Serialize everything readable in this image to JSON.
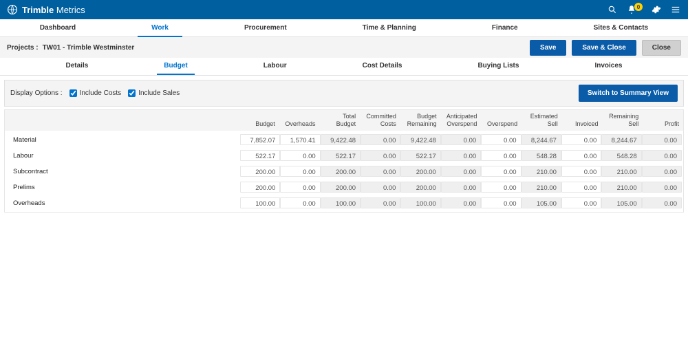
{
  "brand": {
    "logo_name": "trimble-logo",
    "name_bold": "Trimble",
    "name_light": "Metrics"
  },
  "topbar": {
    "notification_count": "0"
  },
  "main_tabs": {
    "items": [
      "Dashboard",
      "Work",
      "Procurement",
      "Time & Planning",
      "Finance",
      "Sites & Contacts"
    ],
    "active_index": 1
  },
  "project_bar": {
    "label": "Projects :",
    "value": "TW01 - Trimble Westminster",
    "save": "Save",
    "save_close": "Save & Close",
    "close": "Close"
  },
  "sub_tabs": {
    "items": [
      "Details",
      "Budget",
      "Labour",
      "Cost Details",
      "Buying Lists",
      "Invoices"
    ],
    "active_index": 1
  },
  "options": {
    "label": "Display Options :",
    "include_costs": "Include Costs",
    "include_sales": "Include Sales",
    "switch_button": "Switch to Summary View",
    "include_costs_checked": true,
    "include_sales_checked": true
  },
  "grid": {
    "headers": [
      "",
      "Budget",
      "Overheads",
      "Total Budget",
      "Committed Costs",
      "Budget Remaining",
      "Anticipated Overspend",
      "Overspend",
      "Estimated Sell",
      "Invoiced",
      "Remaining Sell",
      "Profit"
    ],
    "editable_cols": [
      1,
      2,
      7,
      9
    ],
    "rows": [
      {
        "label": "Material",
        "cells": [
          "7,852.07",
          "1,570.41",
          "9,422.48",
          "0.00",
          "9,422.48",
          "0.00",
          "0.00",
          "8,244.67",
          "0.00",
          "8,244.67",
          "0.00"
        ]
      },
      {
        "label": "Labour",
        "cells": [
          "522.17",
          "0.00",
          "522.17",
          "0.00",
          "522.17",
          "0.00",
          "0.00",
          "548.28",
          "0.00",
          "548.28",
          "0.00"
        ]
      },
      {
        "label": "Subcontract",
        "cells": [
          "200.00",
          "0.00",
          "200.00",
          "0.00",
          "200.00",
          "0.00",
          "0.00",
          "210.00",
          "0.00",
          "210.00",
          "0.00"
        ]
      },
      {
        "label": "Prelims",
        "cells": [
          "200.00",
          "0.00",
          "200.00",
          "0.00",
          "200.00",
          "0.00",
          "0.00",
          "210.00",
          "0.00",
          "210.00",
          "0.00"
        ]
      },
      {
        "label": "Overheads",
        "cells": [
          "100.00",
          "0.00",
          "100.00",
          "0.00",
          "100.00",
          "0.00",
          "0.00",
          "105.00",
          "0.00",
          "105.00",
          "0.00"
        ]
      }
    ]
  }
}
